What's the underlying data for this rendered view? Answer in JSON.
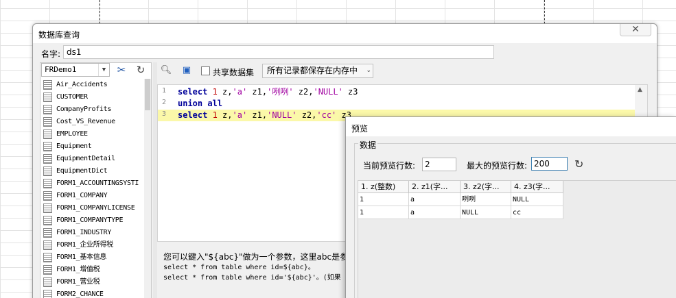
{
  "dialog": {
    "title": "数据库查询",
    "close_label": "✕",
    "name_label": "名字:",
    "name_value": "ds1"
  },
  "left_panel": {
    "database": "FRDemo1",
    "tables": [
      "Air_Accidents",
      "CUSTOMER",
      "CompanyProfits",
      "Cost_VS_Revenue",
      "EMPLOYEE",
      "Equipment",
      "EquipmentDetail",
      "EquipmentDict",
      "FORM1_ACCOUNTINGSYSTI",
      "FORM1_COMPANY",
      "FORM1_COMPANYLICENSE",
      "FORM1_COMPANYTYPE",
      "FORM1_INDUSTRY",
      "FORM1_企业所得税",
      "FORM1_基本信息",
      "FORM1_增值税",
      "FORM1_营业税",
      "FORM2_CHANCE"
    ]
  },
  "sql_toolbar": {
    "share_label": "共享数据集",
    "memory_option": "所有记录都保存在内存中"
  },
  "editor": {
    "line_numbers": [
      "1",
      "2",
      "3"
    ],
    "line1": {
      "kw1": "select",
      "n1": "1",
      "t1": " z,",
      "s1": "'a'",
      "t2": " z1,",
      "s2": "'咧咧'",
      "t3": " z2,",
      "s3": "'NULL'",
      "t4": " z3"
    },
    "line2": {
      "kw1": "union all"
    },
    "line3": {
      "kw1": "select",
      "n1": "1",
      "t1": " z,",
      "s1": "'a'",
      "t2": " z1,",
      "s2": "'NULL'",
      "t3": " z2,",
      "s3": "'cc'",
      "t4": " z3"
    }
  },
  "hint": {
    "line1": "您可以鍵入\"${abc}\"做为一个参数，这里abc是参数",
    "line2": "select * from table where id=${abc}。",
    "line3": "select * from table where id='${abc}'。(如果"
  },
  "preview": {
    "title": "预览",
    "group_label": "数据",
    "current_rows_label": "当前预览行数:",
    "current_rows_value": "2",
    "max_rows_label": "最大的预览行数:",
    "max_rows_value": "200",
    "columns": [
      "1. z(整数)",
      "2. z1(字...",
      "3. z2(字...",
      "4. z3(字..."
    ],
    "rows": [
      [
        "1",
        "a",
        "咧咧",
        "NULL"
      ],
      [
        "1",
        "a",
        "NULL",
        "cc"
      ]
    ]
  }
}
